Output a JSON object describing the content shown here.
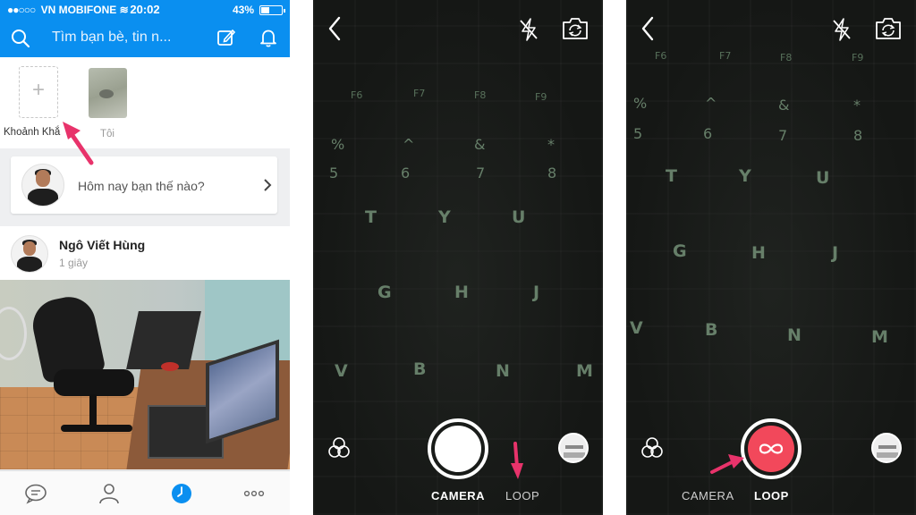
{
  "feed_screen": {
    "status_bar": {
      "carrier": "VN MOBIFONE",
      "time": "20:02",
      "battery": "43%",
      "battery_level": 0.43
    },
    "header": {
      "search_placeholder": "Tìm bạn bè, tin n..."
    },
    "moments": {
      "add_label": "Khoảnh Khắ",
      "me_label": "Tôi"
    },
    "status_prompt": "Hôm nay bạn thế nào?",
    "post": {
      "author": "Ngô Viết Hùng",
      "time": "1 giây"
    },
    "tabs": [
      "messages-icon",
      "contacts-icon",
      "timeline-icon",
      "more-icon"
    ],
    "colors": {
      "brand": "#0a8ff0",
      "annotation_arrow": "#e8336b"
    }
  },
  "camera_screen_1": {
    "modes": {
      "camera": "CAMERA",
      "loop": "LOOP"
    },
    "active_mode": "CAMERA"
  },
  "camera_screen_2": {
    "modes": {
      "camera": "CAMERA",
      "loop": "LOOP"
    },
    "active_mode": "LOOP",
    "shutter_color": "#f2485b"
  },
  "keyboard_keys_1": [
    "F6",
    "F7",
    "F8",
    "F9",
    "%",
    "5",
    "^",
    "6",
    "&",
    "7",
    "*",
    "8",
    "T",
    "Y",
    "U",
    "G",
    "H",
    "J",
    "V",
    "B",
    "N",
    "M"
  ],
  "keyboard_keys_2": [
    "F6",
    "F7",
    "F8",
    "F9",
    "%",
    "5",
    "^",
    "6",
    "&",
    "7",
    "*",
    "8",
    "T",
    "Y",
    "U",
    "G",
    "H",
    "J",
    "V",
    "B",
    "N",
    "M"
  ]
}
